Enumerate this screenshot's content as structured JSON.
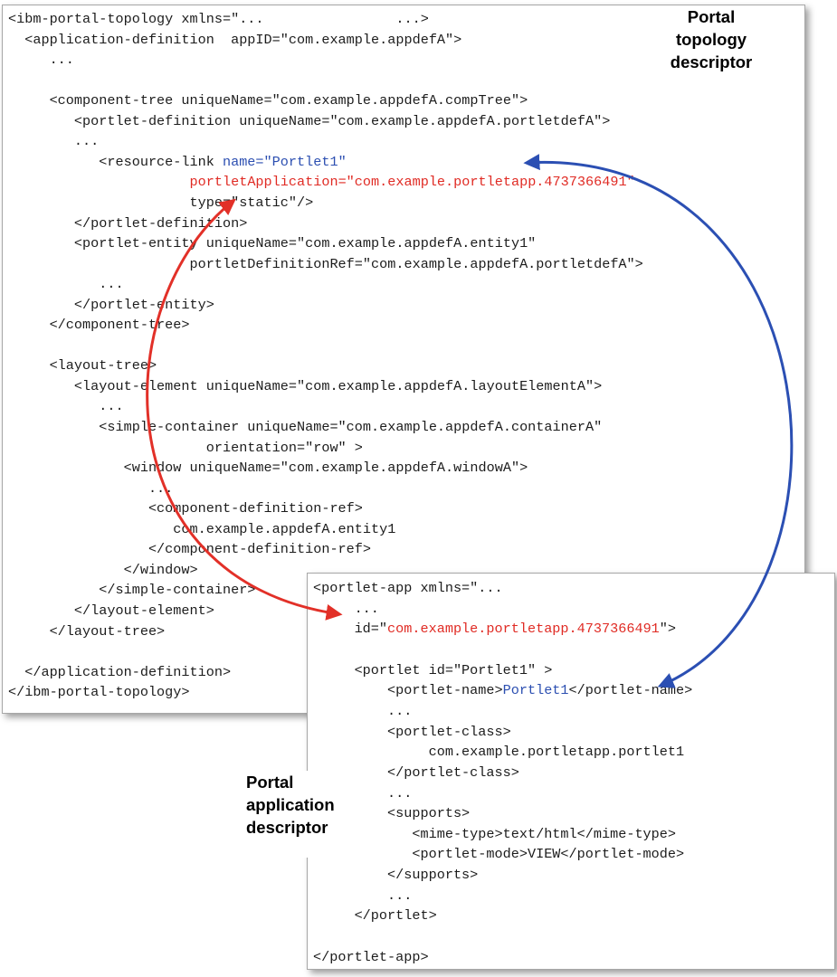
{
  "topology_descriptor": {
    "label": [
      "Portal",
      "topology",
      "descriptor"
    ],
    "lines": [
      [
        {
          "t": "<ibm-portal-topology xmlns=\"...                ...>"
        }
      ],
      [
        {
          "t": "  <application-definition  appID=\"com.example.appdefA\">"
        }
      ],
      [
        {
          "t": "     ..."
        }
      ],
      [
        {
          "t": ""
        }
      ],
      [
        {
          "t": "     <component-tree uniqueName=\"com.example.appdefA.compTree\">"
        }
      ],
      [
        {
          "t": "        <portlet-definition uniqueName=\"com.example.appdefA.portletdefA\">"
        }
      ],
      [
        {
          "t": "        ..."
        }
      ],
      [
        {
          "t": "           <resource-link "
        },
        {
          "t": "name=\"Portlet1\"",
          "c": "blue"
        }
      ],
      [
        {
          "t": "                      "
        },
        {
          "t": "portletApplication=\"com.example.portletapp.4737366491\"",
          "c": "red"
        }
      ],
      [
        {
          "t": "                      type=\"static\"/>"
        }
      ],
      [
        {
          "t": "        </portlet-definition>"
        }
      ],
      [
        {
          "t": "        <portlet-entity uniqueName=\"com.example.appdefA.entity1\""
        }
      ],
      [
        {
          "t": "                      portletDefinitionRef=\"com.example.appdefA.portletdefA\">"
        }
      ],
      [
        {
          "t": "           ..."
        }
      ],
      [
        {
          "t": "        </portlet-entity>"
        }
      ],
      [
        {
          "t": "     </component-tree>"
        }
      ],
      [
        {
          "t": ""
        }
      ],
      [
        {
          "t": "     <layout-tree>"
        }
      ],
      [
        {
          "t": "        <layout-element uniqueName=\"com.example.appdefA.layoutElementA\">"
        }
      ],
      [
        {
          "t": "           ..."
        }
      ],
      [
        {
          "t": "           <simple-container uniqueName=\"com.example.appdefA.containerA\""
        }
      ],
      [
        {
          "t": "                        orientation=\"row\" >"
        }
      ],
      [
        {
          "t": "              <window uniqueName=\"com.example.appdefA.windowA\">"
        }
      ],
      [
        {
          "t": "                 ..."
        }
      ],
      [
        {
          "t": "                 <component-definition-ref>"
        }
      ],
      [
        {
          "t": "                    com.example.appdefA.entity1"
        }
      ],
      [
        {
          "t": "                 </component-definition-ref>"
        }
      ],
      [
        {
          "t": "              </window>"
        }
      ],
      [
        {
          "t": "           </simple-container>"
        }
      ],
      [
        {
          "t": "        </layout-element>"
        }
      ],
      [
        {
          "t": "     </layout-tree>"
        }
      ],
      [
        {
          "t": ""
        }
      ],
      [
        {
          "t": "  </application-definition>"
        }
      ],
      [
        {
          "t": "</ibm-portal-topology>"
        }
      ]
    ]
  },
  "application_descriptor": {
    "label": [
      "Portal",
      "application",
      "descriptor"
    ],
    "lines": [
      [
        {
          "t": "<portlet-app xmlns=\"..."
        }
      ],
      [
        {
          "t": "     ..."
        }
      ],
      [
        {
          "t": "     id=\""
        },
        {
          "t": "com.example.portletapp.4737366491",
          "c": "red"
        },
        {
          "t": "\">"
        }
      ],
      [
        {
          "t": ""
        }
      ],
      [
        {
          "t": "     <portlet id=\"Portlet1\" >"
        }
      ],
      [
        {
          "t": "         <portlet-name>"
        },
        {
          "t": "Portlet1",
          "c": "blue"
        },
        {
          "t": "</portlet-name>"
        }
      ],
      [
        {
          "t": "         ..."
        }
      ],
      [
        {
          "t": "         <portlet-class>"
        }
      ],
      [
        {
          "t": "              com.example.portletapp.portlet1"
        }
      ],
      [
        {
          "t": "         </portlet-class>"
        }
      ],
      [
        {
          "t": "         ..."
        }
      ],
      [
        {
          "t": "         <supports>"
        }
      ],
      [
        {
          "t": "            <mime-type>text/html</mime-type>"
        }
      ],
      [
        {
          "t": "            <portlet-mode>VIEW</portlet-mode>"
        }
      ],
      [
        {
          "t": "         </supports>"
        }
      ],
      [
        {
          "t": "         ..."
        }
      ],
      [
        {
          "t": "     </portlet>"
        }
      ],
      [
        {
          "t": ""
        }
      ],
      [
        {
          "t": "</portlet-app>"
        }
      ]
    ]
  },
  "arrows": [
    {
      "name": "portlet-application-link-arrow",
      "color": "#e23028",
      "connects": "portletApplication to id"
    },
    {
      "name": "portlet-name-link-arrow",
      "color": "#2b4fb3",
      "connects": "name to portlet-name"
    }
  ]
}
